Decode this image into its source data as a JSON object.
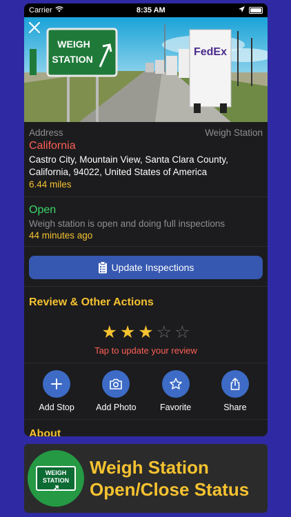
{
  "statusbar": {
    "carrier": "Carrier",
    "time": "8:35 AM"
  },
  "hero": {
    "sign_line1": "WEIGH",
    "sign_line2": "STATION",
    "truck_brand": "FedEx"
  },
  "address": {
    "label": "Address",
    "type": "Weigh Station",
    "state": "California",
    "line1": "Castro City, Mountain View, Santa Clara County,",
    "line2": "California, 94022, United States of America",
    "distance": "6.44 miles"
  },
  "status": {
    "state": "Open",
    "description": "Weigh station is open and doing full inspections",
    "updated": "44 minutes ago"
  },
  "update_button": {
    "label": "Update Inspections"
  },
  "review": {
    "title": "Review & Other Actions",
    "rating": 3,
    "max_rating": 5,
    "prompt": "Tap to update your review"
  },
  "actions": [
    {
      "label": "Add Stop",
      "icon": "plus-icon"
    },
    {
      "label": "Add Photo",
      "icon": "camera-icon"
    },
    {
      "label": "Favorite",
      "icon": "star-icon"
    },
    {
      "label": "Share",
      "icon": "share-icon"
    }
  ],
  "about": {
    "title": "About"
  },
  "banner": {
    "badge_line1": "WEIGH",
    "badge_line2": "STATION",
    "line1": "Weigh Station",
    "line2": "Open/Close Status"
  },
  "colors": {
    "background": "#2f2aa3",
    "accent_yellow": "#f5c230",
    "open_green": "#3dd56a",
    "alert_red": "#ff5f57",
    "button_blue": "#3658b0"
  }
}
